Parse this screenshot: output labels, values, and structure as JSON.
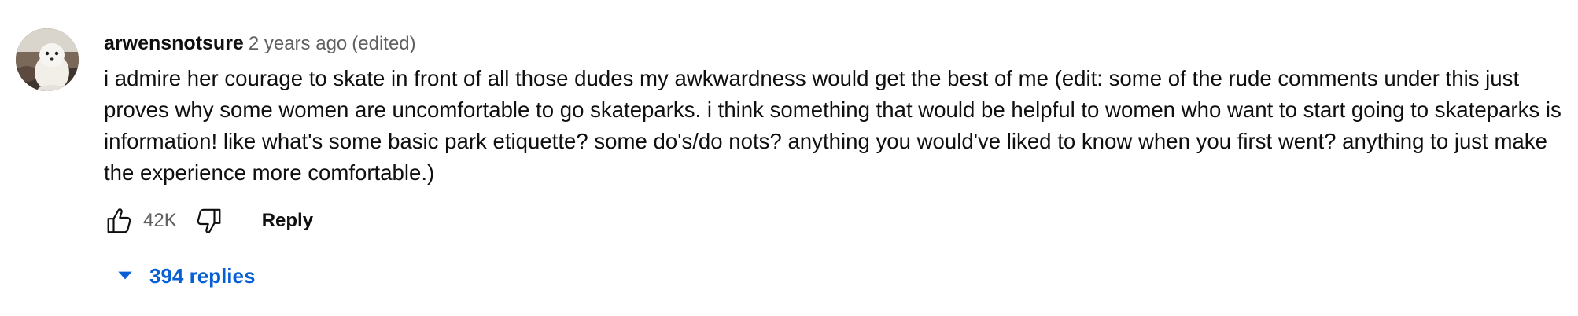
{
  "comment": {
    "author": "arwensnotsure",
    "timestamp": "2 years ago",
    "edited_label": "(edited)",
    "text": "i admire her courage to skate in front of all those dudes my awkwardness would get the best of me (edit: some of the rude comments under this just proves why some women are uncomfortable to go skateparks. i think something that would be helpful to women who want to start going to skateparks is information! like what's some basic park etiquette? some do's/do nots? anything you would've liked to know when you first went? anything to just make the experience more comfortable.)",
    "like_count": "42K",
    "reply_label": "Reply",
    "replies_label": "394 replies"
  },
  "icons": {
    "like": "thumbs-up-icon",
    "dislike": "thumbs-down-icon",
    "expand": "caret-down-icon"
  },
  "colors": {
    "link_blue": "#065fd4",
    "secondary_text": "#606060",
    "primary_text": "#0f0f0f"
  }
}
